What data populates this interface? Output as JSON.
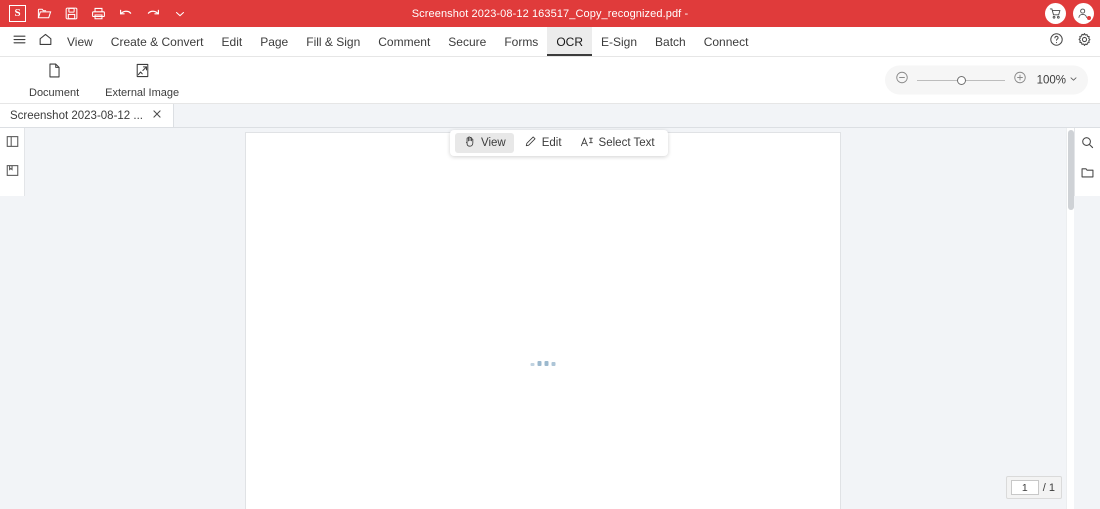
{
  "titlebar": {
    "logo": "S",
    "document_title": "Screenshot 2023-08-12 163517_Copy_recognized.pdf -",
    "quick_access": [
      {
        "name": "open-file-icon",
        "label": "Open"
      },
      {
        "name": "save-icon",
        "label": "Save"
      },
      {
        "name": "print-icon",
        "label": "Print"
      },
      {
        "name": "undo-icon",
        "label": "Undo"
      },
      {
        "name": "redo-icon",
        "label": "Redo"
      },
      {
        "name": "chevron-down-icon",
        "label": "More"
      }
    ],
    "cart_label": "Cart",
    "account_label": "Account"
  },
  "menubar": {
    "hamburger_label": "Menu",
    "home_label": "Home",
    "items": [
      {
        "label": "View",
        "active": false
      },
      {
        "label": "Create & Convert",
        "active": false
      },
      {
        "label": "Edit",
        "active": false
      },
      {
        "label": "Page",
        "active": false
      },
      {
        "label": "Fill & Sign",
        "active": false
      },
      {
        "label": "Comment",
        "active": false
      },
      {
        "label": "Secure",
        "active": false
      },
      {
        "label": "Forms",
        "active": false
      },
      {
        "label": "OCR",
        "active": true
      },
      {
        "label": "E-Sign",
        "active": false
      },
      {
        "label": "Batch",
        "active": false
      },
      {
        "label": "Connect",
        "active": false
      }
    ],
    "help_label": "Help",
    "settings_label": "Settings"
  },
  "ribbon": {
    "buttons": [
      {
        "label": "Document",
        "icon": "document-icon"
      },
      {
        "label": "External Image",
        "icon": "external-image-icon"
      }
    ],
    "zoom": {
      "minus_label": "Zoom out",
      "plus_label": "Zoom in",
      "level": "100%",
      "chevron": "⌄"
    }
  },
  "tabstrip": {
    "tabs": [
      {
        "label": "Screenshot 2023-08-12 ...",
        "close_label": "Close tab"
      }
    ]
  },
  "left_rail": {
    "items": [
      {
        "name": "page-thumbnails-panel-icon",
        "label": "Thumbnails"
      },
      {
        "name": "bookmarks-panel-icon",
        "label": "Bookmarks"
      }
    ]
  },
  "right_rail": {
    "items": [
      {
        "name": "search-icon",
        "label": "Search"
      },
      {
        "name": "panel-icon",
        "label": "Panels"
      }
    ]
  },
  "float_toolbar": {
    "buttons": [
      {
        "label": "View",
        "icon": "hand-icon",
        "active": true
      },
      {
        "label": "Edit",
        "icon": "pencil-icon",
        "active": false
      },
      {
        "label": "Select Text",
        "icon": "select-text-icon",
        "active": false
      }
    ]
  },
  "viewer": {
    "loading_label": "Loading",
    "page_current": "1",
    "page_total": "/ 1"
  },
  "colors": {
    "brand_red": "#e03b3b",
    "workspace_gray": "#f2f4f7",
    "text_primary": "#3c3c3c",
    "accent_loading": "#4a7fa6"
  }
}
